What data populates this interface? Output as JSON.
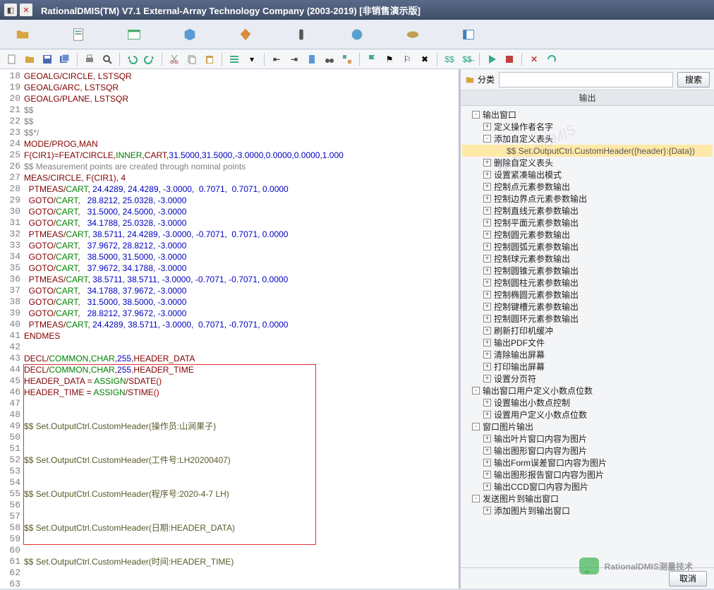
{
  "titlebar": {
    "title": "RationalDMIS(TM) V7.1    External-Array Technology Company (2003-2019) [非销售演示版]"
  },
  "search": {
    "placeholder": "",
    "button": "搜索",
    "category": "分类"
  },
  "tabbar": {
    "label": "输出"
  },
  "bottom": {
    "cancel": "取消"
  },
  "watermark": {
    "text": "RationalDMIS测量技术",
    "faint": "RationalDMIS"
  },
  "code_lines": [
    {
      "n": 18,
      "t": "GEOALG/CIRCLE, LSTSQR",
      "s": "ident"
    },
    {
      "n": 19,
      "t": "GEOALG/ARC, LSTSQR",
      "s": "ident"
    },
    {
      "n": 20,
      "t": "GEOALG/PLANE, LSTSQR",
      "s": "ident"
    },
    {
      "n": 21,
      "t": "$$",
      "s": "cmt"
    },
    {
      "n": 22,
      "t": "$$",
      "s": "cmt"
    },
    {
      "n": 23,
      "t": "$$*/",
      "s": "cmt"
    },
    {
      "n": 24,
      "html": "<span class='ident'>MODE/PROG,MAN</span>"
    },
    {
      "n": 25,
      "html": "<span class='ident'>F(CIR1)=FEAT/CIRCLE,</span><span class='green'>INNER</span><span class='ident'>,CART,</span><span class='num'>31.5000,31.5000,-3.0000,0.0000,0.0000,1.000</span>"
    },
    {
      "n": 26,
      "html": "<span class='cmt'>$$ Measurement points are created through nominal points</span>"
    },
    {
      "n": 27,
      "html": "<span class='ident'>MEAS/CIRCLE, F(CIR1), 4</span>"
    },
    {
      "n": 28,
      "html": "<span class='ident'>  PTMEAS/</span><span class='green'>CART</span><span class='ident'>, </span><span class='num'>24.4289, 24.4289, -3.0000,  0.7071,  0.7071, 0.0000</span>"
    },
    {
      "n": 29,
      "html": "<span class='ident'>  GOTO/</span><span class='green'>CART</span><span class='ident'>,   </span><span class='num'>28.8212, 25.0328, -3.0000</span>"
    },
    {
      "n": 30,
      "html": "<span class='ident'>  GOTO/</span><span class='green'>CART</span><span class='ident'>,   </span><span class='num'>31.5000, 24.5000, -3.0000</span>"
    },
    {
      "n": 31,
      "html": "<span class='ident'>  GOTO/</span><span class='green'>CART</span><span class='ident'>,   </span><span class='num'>34.1788, 25.0328, -3.0000</span>"
    },
    {
      "n": 32,
      "html": "<span class='ident'>  PTMEAS/</span><span class='green'>CART</span><span class='ident'>, </span><span class='num'>38.5711, 24.4289, -3.0000, -0.7071,  0.7071, 0.0000</span>"
    },
    {
      "n": 33,
      "html": "<span class='ident'>  GOTO/</span><span class='green'>CART</span><span class='ident'>,   </span><span class='num'>37.9672, 28.8212, -3.0000</span>"
    },
    {
      "n": 34,
      "html": "<span class='ident'>  GOTO/</span><span class='green'>CART</span><span class='ident'>,   </span><span class='num'>38.5000, 31.5000, -3.0000</span>"
    },
    {
      "n": 35,
      "html": "<span class='ident'>  GOTO/</span><span class='green'>CART</span><span class='ident'>,   </span><span class='num'>37.9672, 34.1788, -3.0000</span>"
    },
    {
      "n": 36,
      "html": "<span class='ident'>  PTMEAS/</span><span class='green'>CART</span><span class='ident'>, </span><span class='num'>38.5711, 38.5711, -3.0000, -0.7071, -0.7071, 0.0000</span>"
    },
    {
      "n": 37,
      "html": "<span class='ident'>  GOTO/</span><span class='green'>CART</span><span class='ident'>,   </span><span class='num'>34.1788, 37.9672, -3.0000</span>"
    },
    {
      "n": 38,
      "html": "<span class='ident'>  GOTO/</span><span class='green'>CART</span><span class='ident'>,   </span><span class='num'>31.5000, 38.5000, -3.0000</span>"
    },
    {
      "n": 39,
      "html": "<span class='ident'>  GOTO/</span><span class='green'>CART</span><span class='ident'>,   </span><span class='num'>28.8212, 37.9672, -3.0000</span>"
    },
    {
      "n": 40,
      "html": "<span class='ident'>  PTMEAS/</span><span class='green'>CART</span><span class='ident'>, </span><span class='num'>24.4289, 38.5711, -3.0000,  0.7071, -0.7071, 0.0000</span>"
    },
    {
      "n": 41,
      "html": "<span class='ident'>ENDMES</span>"
    },
    {
      "n": 42,
      "t": "",
      "s": "blk"
    },
    {
      "n": 43,
      "html": "<span class='ident'>DECL/</span><span class='green'>COMMON</span><span class='ident'>,</span><span class='green'>CHAR</span><span class='ident'>,</span><span class='num'>255</span><span class='ident'>,HEADER_DATA</span>"
    },
    {
      "n": 44,
      "html": "<span class='ident'>DECL/</span><span class='green'>COMMON</span><span class='ident'>,</span><span class='green'>CHAR</span><span class='ident'>,</span><span class='num'>255</span><span class='ident'>,HEADER_TIME</span>"
    },
    {
      "n": 45,
      "html": "<span class='ident'>HEADER_DATA = </span><span class='green'>ASSIGN</span><span class='ident'>/SDATE</span><span class='red'>()</span>"
    },
    {
      "n": 46,
      "html": "<span class='ident'>HEADER_TIME = </span><span class='green'>ASSIGN</span><span class='ident'>/STIME</span><span class='red'>()</span>"
    },
    {
      "n": 47,
      "t": "",
      "s": "blk"
    },
    {
      "n": 48,
      "t": "",
      "s": "blk"
    },
    {
      "n": 49,
      "html": "<span class='olive'>$$ Set.OutputCtrl.CustomHeader(操作员:山涧果子)</span>"
    },
    {
      "n": 50,
      "t": "",
      "s": "blk"
    },
    {
      "n": 51,
      "t": "",
      "s": "blk"
    },
    {
      "n": 52,
      "html": "<span class='olive'>$$ Set.OutputCtrl.CustomHeader(工件号:LH20200407)</span>"
    },
    {
      "n": 53,
      "t": "",
      "s": "blk"
    },
    {
      "n": 54,
      "t": "",
      "s": "blk"
    },
    {
      "n": 55,
      "html": "<span class='olive'>$$ Set.OutputCtrl.CustomHeader(程序号:2020-4-7 LH)</span>"
    },
    {
      "n": 56,
      "t": "",
      "s": "blk"
    },
    {
      "n": 57,
      "t": "",
      "s": "blk"
    },
    {
      "n": 58,
      "html": "<span class='olive'>$$ Set.OutputCtrl.CustomHeader(日期:HEADER_DATA)</span>"
    },
    {
      "n": 59,
      "t": "",
      "s": "blk"
    },
    {
      "n": 60,
      "t": "",
      "s": "blk"
    },
    {
      "n": 61,
      "html": "<span class='olive'>$$ Set.OutputCtrl.CustomHeader(时间:HEADER_TIME)</span>"
    },
    {
      "n": 62,
      "t": "",
      "s": "blk"
    },
    {
      "n": 63,
      "t": "",
      "s": "blk"
    }
  ],
  "tree": [
    {
      "lvl": 1,
      "tgl": "-",
      "label": "输出窗口"
    },
    {
      "lvl": 2,
      "tgl": "+",
      "label": "定义操作者名字"
    },
    {
      "lvl": 2,
      "tgl": "-",
      "label": "添加自定义表头"
    },
    {
      "lvl": 3,
      "tgl": "",
      "label": "$$ Set.OutputCtrl.CustomHeader({header}:{Data})",
      "sel": true
    },
    {
      "lvl": 2,
      "tgl": "+",
      "label": "删除自定义表头"
    },
    {
      "lvl": 2,
      "tgl": "+",
      "label": "设置紧凑输出模式"
    },
    {
      "lvl": 2,
      "tgl": "+",
      "label": "控制点元素参数输出"
    },
    {
      "lvl": 2,
      "tgl": "+",
      "label": "控制边界点元素参数输出"
    },
    {
      "lvl": 2,
      "tgl": "+",
      "label": "控制直线元素参数输出"
    },
    {
      "lvl": 2,
      "tgl": "+",
      "label": "控制平面元素参数输出"
    },
    {
      "lvl": 2,
      "tgl": "+",
      "label": "控制圆元素参数输出"
    },
    {
      "lvl": 2,
      "tgl": "+",
      "label": "控制圆弧元素参数输出"
    },
    {
      "lvl": 2,
      "tgl": "+",
      "label": "控制球元素参数输出"
    },
    {
      "lvl": 2,
      "tgl": "+",
      "label": "控制圆锥元素参数输出"
    },
    {
      "lvl": 2,
      "tgl": "+",
      "label": "控制圆柱元素参数输出"
    },
    {
      "lvl": 2,
      "tgl": "+",
      "label": "控制椭圆元素参数输出"
    },
    {
      "lvl": 2,
      "tgl": "+",
      "label": "控制键槽元素参数输出"
    },
    {
      "lvl": 2,
      "tgl": "+",
      "label": "控制圆环元素参数输出"
    },
    {
      "lvl": 2,
      "tgl": "+",
      "label": "刷新打印机缓冲"
    },
    {
      "lvl": 2,
      "tgl": "+",
      "label": "输出PDF文件"
    },
    {
      "lvl": 2,
      "tgl": "+",
      "label": "清除输出屏幕"
    },
    {
      "lvl": 2,
      "tgl": "+",
      "label": "打印输出屏幕"
    },
    {
      "lvl": 2,
      "tgl": "+",
      "label": "设置分页符"
    },
    {
      "lvl": 1,
      "tgl": "-",
      "label": "输出窗口用户定义小数点位数"
    },
    {
      "lvl": 2,
      "tgl": "+",
      "label": "设置输出小数点控制"
    },
    {
      "lvl": 2,
      "tgl": "+",
      "label": "设置用户定义小数点位数"
    },
    {
      "lvl": 1,
      "tgl": "-",
      "label": "窗口图片输出"
    },
    {
      "lvl": 2,
      "tgl": "+",
      "label": "输出叶片窗口内容为图片"
    },
    {
      "lvl": 2,
      "tgl": "+",
      "label": "输出图形窗口内容为图片"
    },
    {
      "lvl": 2,
      "tgl": "+",
      "label": "输出Form误差窗口内容为图片"
    },
    {
      "lvl": 2,
      "tgl": "+",
      "label": "输出图形报告窗口内容为图片"
    },
    {
      "lvl": 2,
      "tgl": "+",
      "label": "输出CCD窗口内容为图片"
    },
    {
      "lvl": 1,
      "tgl": "-",
      "label": "发送图片到输出窗口"
    },
    {
      "lvl": 2,
      "tgl": "+",
      "label": "添加图片到输出窗口"
    }
  ]
}
